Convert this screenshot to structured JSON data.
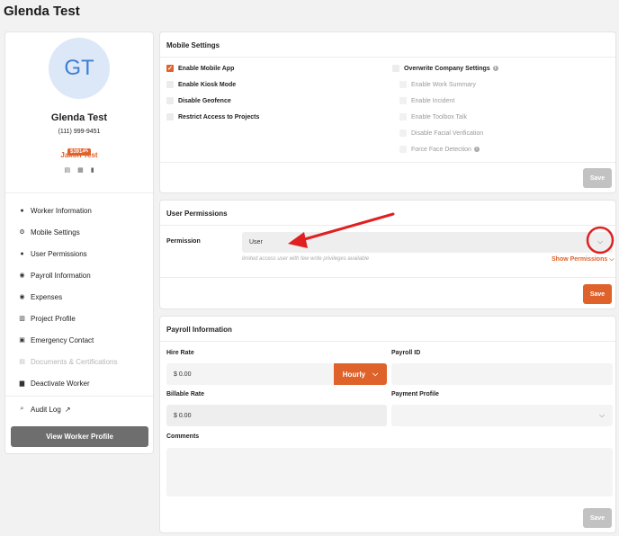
{
  "page": {
    "title": "Glenda Test"
  },
  "profile": {
    "initials": "GT",
    "name": "Glenda Test",
    "phone": "(111) 999-9451",
    "badge": "$39145",
    "company": "Jaxon Test",
    "icons": [
      "id-card-icon",
      "list-icon",
      "phone-icon"
    ]
  },
  "nav": {
    "items": [
      {
        "label": "Worker Information",
        "icon": "person-icon"
      },
      {
        "label": "Mobile Settings",
        "icon": "sliders-icon"
      },
      {
        "label": "User Permissions",
        "icon": "user-lock-icon"
      },
      {
        "label": "Payroll Information",
        "icon": "dollar-icon"
      },
      {
        "label": "Expenses",
        "icon": "dollar-circle-icon"
      },
      {
        "label": "Project Profile",
        "icon": "building-icon"
      },
      {
        "label": "Emergency Contact",
        "icon": "contact-card-icon"
      },
      {
        "label": "Documents & Certifications",
        "icon": "document-icon"
      },
      {
        "label": "Deactivate Worker",
        "icon": "trash-icon"
      }
    ],
    "audit_log": "Audit Log",
    "view_profile": "View Worker Profile"
  },
  "mobile_settings": {
    "title": "Mobile Settings",
    "left": [
      {
        "label": "Enable Mobile App",
        "checked": true
      },
      {
        "label": "Enable Kiosk Mode",
        "checked": false
      },
      {
        "label": "Disable Geofence",
        "checked": false
      },
      {
        "label": "Restrict Access to Projects",
        "checked": false
      }
    ],
    "overwrite": "Overwrite Company Settings",
    "right": [
      "Enable Work Summary",
      "Enable Incident",
      "Enable Toolbox Talk",
      "Disable Facial Verification",
      "Force Face Detection"
    ],
    "save": "Save"
  },
  "user_permissions": {
    "title": "User Permissions",
    "label": "Permission",
    "value": "User",
    "hint": "limited access user with few write privileges available",
    "show_permissions": "Show Permissions",
    "save": "Save"
  },
  "payroll": {
    "title": "Payroll Information",
    "hire_rate_label": "Hire Rate",
    "hire_rate": "$ 0.00",
    "rate_type": "Hourly",
    "payroll_id_label": "Payroll ID",
    "payroll_id": "",
    "billable_label": "Billable Rate",
    "billable_rate": "$ 0.00",
    "payment_profile_label": "Payment Profile",
    "payment_profile": "",
    "comments_label": "Comments",
    "comments": "",
    "save": "Save"
  },
  "colors": {
    "accent": "#e0622b",
    "annotation": "#e02020"
  }
}
